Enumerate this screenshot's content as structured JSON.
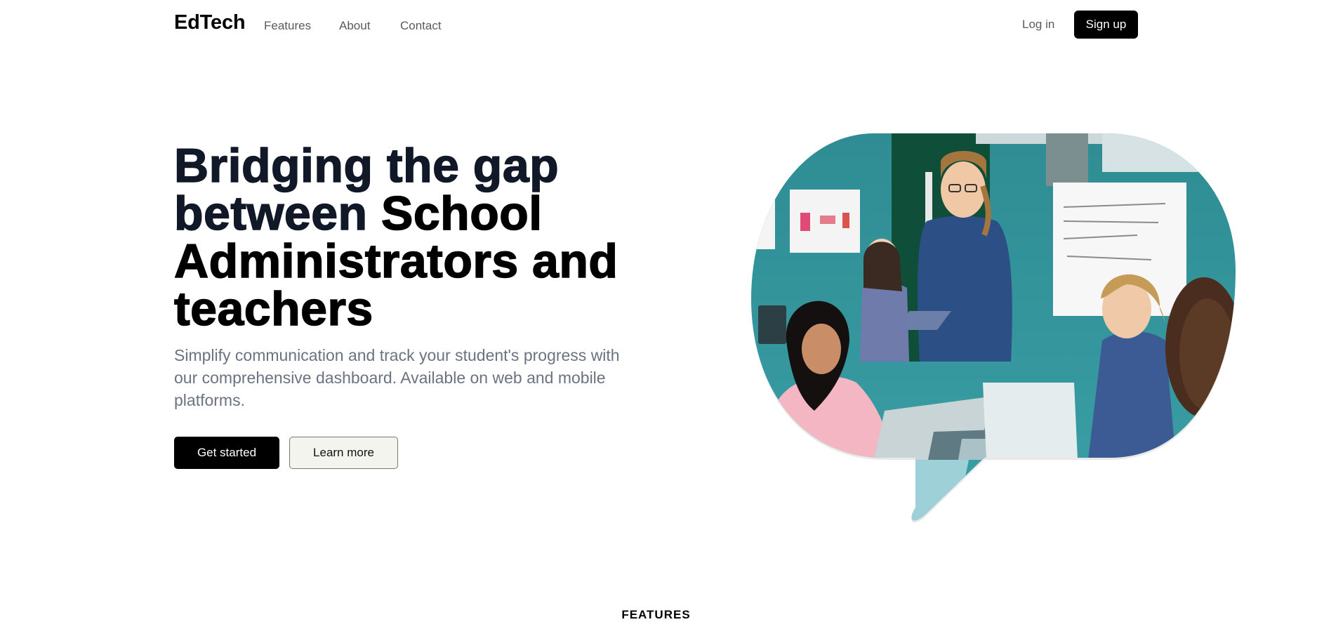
{
  "nav": {
    "logo": "EdTech",
    "links": [
      "Features",
      "About",
      "Contact"
    ],
    "login": "Log in",
    "signup": "Sign up"
  },
  "hero": {
    "title_part1": "Bridging the gap between",
    "title_part2": "School Administrators and teachers",
    "subtitle": "Simplify communication and track your student's progress with our comprehensive dashboard. Available on web and mobile platforms.",
    "primary_cta": "Get started",
    "secondary_cta": "Learn more"
  },
  "sections": {
    "features_label": "FEATURES"
  },
  "colors": {
    "primary": "#000000",
    "heading_dark": "#111827",
    "muted_text": "#6b7280",
    "secondary_button_bg": "#f3f4ee",
    "image_wall_teal": "#2f8c93"
  }
}
